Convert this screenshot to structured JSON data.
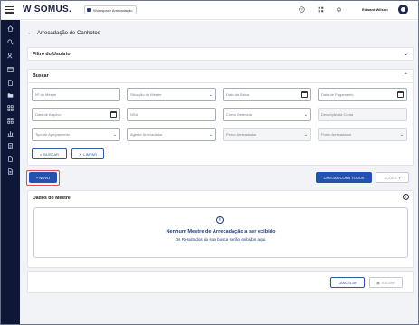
{
  "topbar": {
    "logo": "SOMUS.",
    "workspace": "Workspace Arrecadação",
    "user_name": "Edward Wilson",
    "icons": [
      "menu-icon",
      "help-icon",
      "apps-icon",
      "bell-icon",
      "avatar"
    ]
  },
  "sidebar": {
    "items": [
      "home-icon",
      "search-icon",
      "users-icon",
      "card-icon",
      "document-icon",
      "folder-icon",
      "grid-icon",
      "grid-icon",
      "chart-icon",
      "report-icon",
      "file-icon",
      "file-icon"
    ]
  },
  "page": {
    "title": "Arrecadação de Canhotos"
  },
  "filtro": {
    "title": "Filtro do Usuário"
  },
  "buscar": {
    "title": "Buscar",
    "fields": {
      "nf_mestre": "Nº do Mestre",
      "situacao": "Situação do Mestre",
      "data_baixa": "Data da Baixa",
      "data_pagamento": "Data de Pagamento",
      "data_arquivo": "Data de Arquivo",
      "nsa": "NSA",
      "conta_gerencial": "Conta Gerencial",
      "descricao_conta": "Descrição da Conta",
      "tipo_agrupamento": "Tipo de Agrupamento",
      "agente": "Agente Arrecadador",
      "ponto_arrecadador_1": "Ponto Arrecadador",
      "ponto_arrecadador_2": "Ponto Arrecadador"
    },
    "btn_buscar": "BUSCAR",
    "btn_limpar": "LIMPAR"
  },
  "toolbar": {
    "novo": "+ NOVO",
    "checar": "CHECAR/CONS TODOS",
    "acoes": "AÇÕES"
  },
  "dados": {
    "title": "Dados do Mestre",
    "empty_title": "Nenhum Mestre de Arrecadação a ser exibido",
    "empty_sub": "Os Resultados da sua busca serão exibidos aqui."
  },
  "footer": {
    "cancelar": "CANCELAR",
    "salvar": "SALVAR"
  },
  "colors": {
    "sidebar": "#0e1738",
    "primary": "#2452b0",
    "accent_text": "#1f3f7e",
    "highlight": "#e24b4b"
  }
}
